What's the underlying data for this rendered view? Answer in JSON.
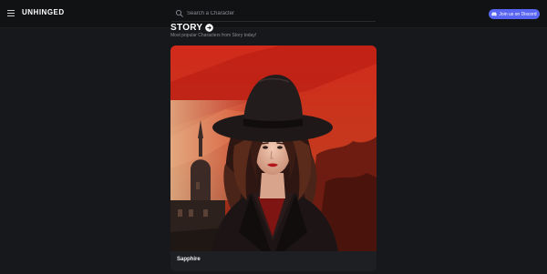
{
  "app": {
    "logo": "UNHINGED"
  },
  "header": {
    "menu_icon": "hamburger-icon",
    "search": {
      "placeholder": "Search a Character",
      "icon": "search-icon"
    },
    "discord_button": {
      "label": "Join us on Discord",
      "icon": "discord-icon"
    }
  },
  "section": {
    "title": "STORY",
    "title_icon": "arrow-right-circle-icon",
    "subtitle": "Most popular Characters from Story today!"
  },
  "cards": [
    {
      "name": "Sapphire"
    }
  ],
  "colors": {
    "background": "#17181b",
    "topbar": "#111214",
    "accent": "#5865f2",
    "card": "#1e1f22"
  }
}
